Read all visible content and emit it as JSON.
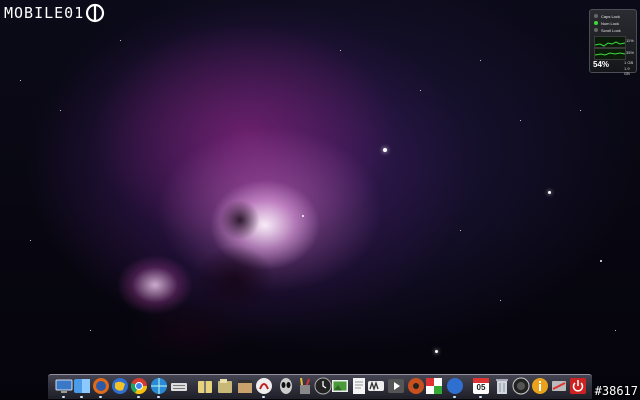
{
  "logo": {
    "text": "MOBILE01"
  },
  "system_widget": {
    "locks": [
      {
        "label": "Caps Lock",
        "on": false
      },
      {
        "label": "Num Lock",
        "on": true
      },
      {
        "label": "Scroll Lock",
        "on": false
      }
    ],
    "graph_top_value": "11%",
    "graph_bottom_value": "35%",
    "cpu_percent": "54%",
    "memory_lines": [
      "1 GB",
      "1.9 GB"
    ]
  },
  "dock": {
    "icons": [
      "monitor-icon",
      "finder-icon",
      "firefox-icon",
      "google-earth-icon",
      "chrome-icon",
      "network-globe-icon",
      "keyboard-icon",
      "zip-folder-icon",
      "documents-folder-icon",
      "clapperboard-icon",
      "adobe-reader-icon",
      "alien-icon",
      "pencil-cup-icon",
      "clock-icon",
      "image-viewer-icon",
      "text-document-icon",
      "mvp-player-icon",
      "media-player-icon",
      "music-game-icon",
      "chess-icon",
      "safari-like-icon",
      "calendar-icon",
      "trash-icon",
      "photo-booth-icon",
      "info-icon",
      "storage-icon",
      "power-icon"
    ],
    "calendar_day": "05"
  },
  "watermark": "#38617"
}
